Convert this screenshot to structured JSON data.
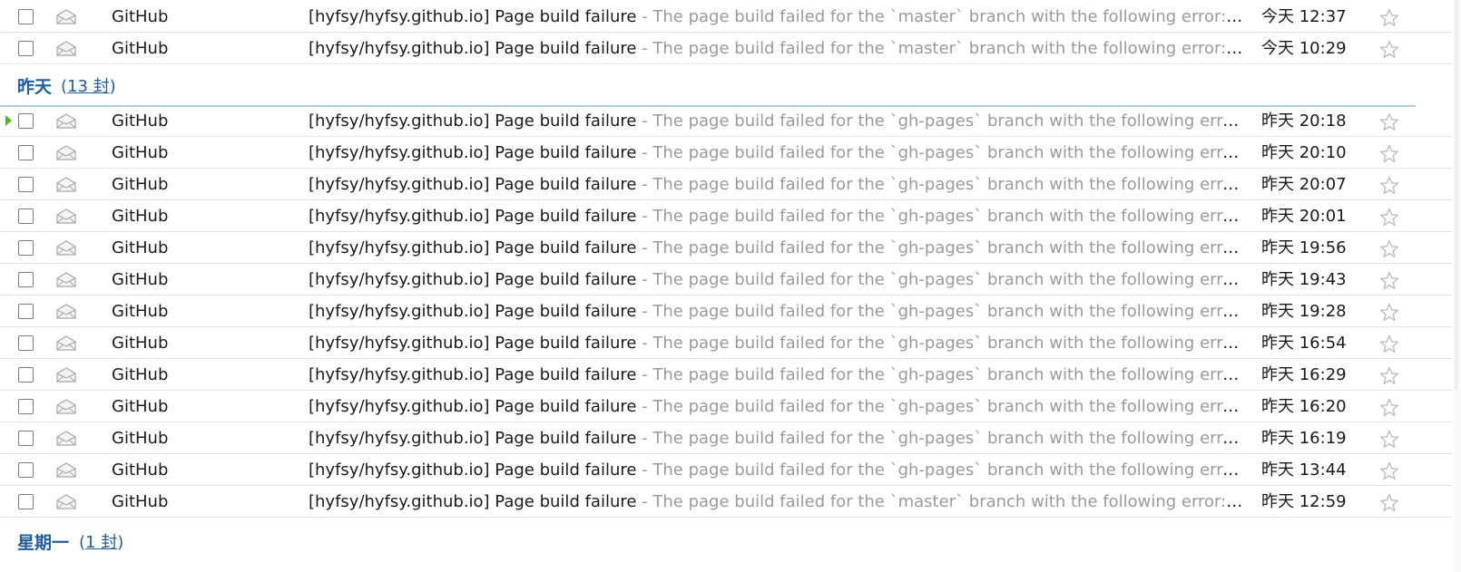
{
  "groups": [
    {
      "title": "",
      "count_text": "",
      "rows": [
        {
          "sender": "GitHub",
          "subject": "[hyfsy/hyfsy.github.io] Page build failure",
          "summary": " - The page build failed for the `master` branch with the following error:Y...",
          "time": "今天 12:37"
        },
        {
          "sender": "GitHub",
          "subject": "[hyfsy/hyfsy.github.io] Page build failure",
          "summary": " - The page build failed for the `master` branch with the following error:Y...",
          "time": "今天 10:29"
        }
      ]
    },
    {
      "title": "昨天",
      "count_prefix": "(",
      "count_text": "13 封",
      "count_suffix": ")",
      "rows": [
        {
          "sender": "GitHub",
          "subject": "[hyfsy/hyfsy.github.io] Page build failure",
          "summary": " - The page build failed for the `gh-pages` branch with the following erro...",
          "time": "昨天 20:18"
        },
        {
          "sender": "GitHub",
          "subject": "[hyfsy/hyfsy.github.io] Page build failure",
          "summary": " - The page build failed for the `gh-pages` branch with the following erro...",
          "time": "昨天 20:10"
        },
        {
          "sender": "GitHub",
          "subject": "[hyfsy/hyfsy.github.io] Page build failure",
          "summary": " - The page build failed for the `gh-pages` branch with the following erro...",
          "time": "昨天 20:07"
        },
        {
          "sender": "GitHub",
          "subject": "[hyfsy/hyfsy.github.io] Page build failure",
          "summary": " - The page build failed for the `gh-pages` branch with the following erro...",
          "time": "昨天 20:01"
        },
        {
          "sender": "GitHub",
          "subject": "[hyfsy/hyfsy.github.io] Page build failure",
          "summary": " - The page build failed for the `gh-pages` branch with the following erro...",
          "time": "昨天 19:56"
        },
        {
          "sender": "GitHub",
          "subject": "[hyfsy/hyfsy.github.io] Page build failure",
          "summary": " - The page build failed for the `gh-pages` branch with the following erro...",
          "time": "昨天 19:43"
        },
        {
          "sender": "GitHub",
          "subject": "[hyfsy/hyfsy.github.io] Page build failure",
          "summary": " - The page build failed for the `gh-pages` branch with the following erro...",
          "time": "昨天 19:28"
        },
        {
          "sender": "GitHub",
          "subject": "[hyfsy/hyfsy.github.io] Page build failure",
          "summary": " - The page build failed for the `gh-pages` branch with the following erro...",
          "time": "昨天 16:54"
        },
        {
          "sender": "GitHub",
          "subject": "[hyfsy/hyfsy.github.io] Page build failure",
          "summary": " - The page build failed for the `gh-pages` branch with the following erro...",
          "time": "昨天 16:29"
        },
        {
          "sender": "GitHub",
          "subject": "[hyfsy/hyfsy.github.io] Page build failure",
          "summary": " - The page build failed for the `gh-pages` branch with the following erro...",
          "time": "昨天 16:20"
        },
        {
          "sender": "GitHub",
          "subject": "[hyfsy/hyfsy.github.io] Page build failure",
          "summary": " - The page build failed for the `gh-pages` branch with the following erro...",
          "time": "昨天 16:19"
        },
        {
          "sender": "GitHub",
          "subject": "[hyfsy/hyfsy.github.io] Page build failure",
          "summary": " - The page build failed for the `gh-pages` branch with the following erro...",
          "time": "昨天 13:44"
        },
        {
          "sender": "GitHub",
          "subject": "[hyfsy/hyfsy.github.io] Page build failure",
          "summary": " - The page build failed for the `master` branch with the following error:A...",
          "time": "昨天 12:59"
        }
      ]
    },
    {
      "title": "星期一",
      "count_prefix": "(",
      "count_text": "1 封",
      "count_suffix": ")",
      "rows": []
    }
  ],
  "icons": {
    "row_read_state": "envelope-open-icon",
    "row_star": "star-outline-icon",
    "current_row_marker": "green-arrow-marker"
  },
  "colors": {
    "group_title": "#1e5fa0",
    "summary_text": "#9a9a9a",
    "row_border": "#e3e3e3",
    "group_divider": "#b4c9de",
    "current_marker": "#4fb81d"
  }
}
